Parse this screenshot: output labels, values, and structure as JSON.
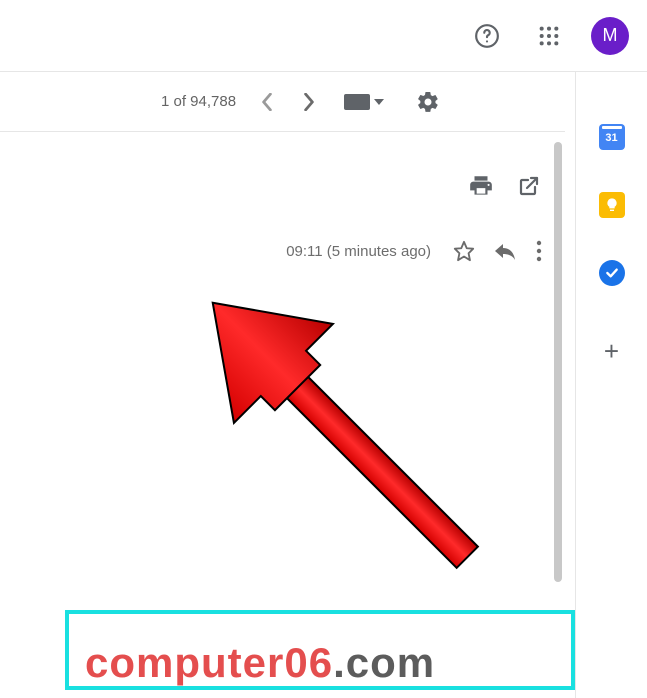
{
  "header": {
    "avatar_initial": "M"
  },
  "toolbar": {
    "counter": "1 of 94,788"
  },
  "message": {
    "timestamp": "09:11 (5 minutes ago)"
  },
  "sidepanel": {
    "calendar_day": "31"
  },
  "watermark": {
    "part1": "computer06",
    "part2": ".com"
  }
}
